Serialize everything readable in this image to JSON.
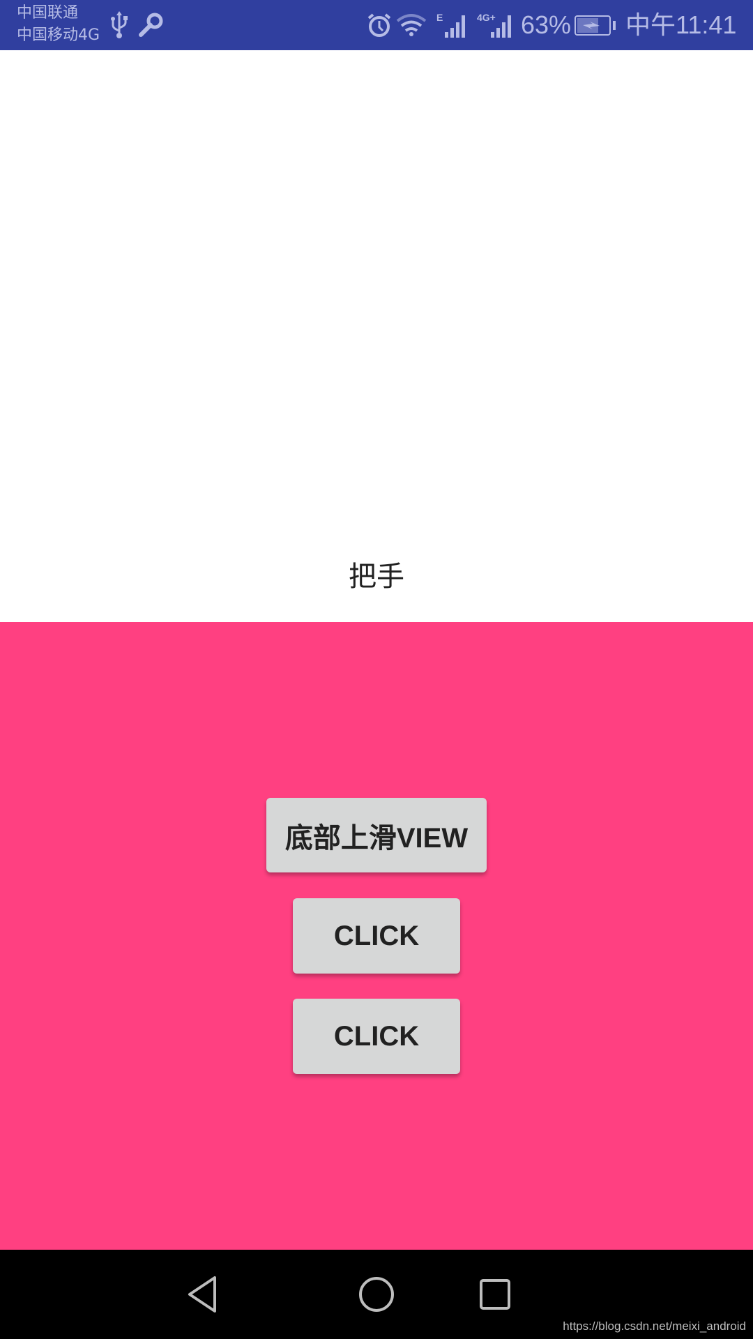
{
  "status_bar": {
    "carrier_1": "中国联通",
    "carrier_2": "中国移动4G",
    "icons": [
      "usb-icon",
      "key-icon",
      "alarm-icon",
      "wifi-icon",
      "signal-e-icon",
      "signal-4g-plus-icon",
      "battery-charging-icon"
    ],
    "battery_percent": "63%",
    "time": "中午11:41",
    "signal_1_type": "E",
    "signal_2_type": "4G+",
    "background_color": "#303F9F"
  },
  "main": {
    "handle_label": "把手",
    "panel_color": "#FF4081",
    "buttons": [
      {
        "label": "底部上滑VIEW"
      },
      {
        "label": "CLICK"
      },
      {
        "label": "CLICK"
      }
    ]
  },
  "nav_bar": {
    "buttons": [
      "back-icon",
      "home-icon",
      "recents-icon"
    ]
  },
  "watermark": "https://blog.csdn.net/meixi_android"
}
